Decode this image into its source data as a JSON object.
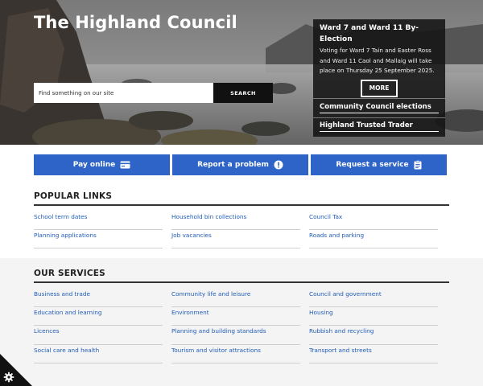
{
  "header": {
    "site_title": "The Highland Council"
  },
  "search": {
    "placeholder": "Find something on our site",
    "button_label": "SEARCH"
  },
  "news_panel": {
    "title": "Ward 7 and Ward 11 By-Election",
    "body": "Voting for Ward 7 Tain and Easter Ross and Ward 11 Caol and Mallaig will take place on Thursday 25 September 2025.",
    "more_label": "MORE",
    "links": [
      "Community Council elections",
      "Highland Trusted Trader"
    ]
  },
  "actions": [
    {
      "label": "Pay online",
      "icon": "credit-card-icon"
    },
    {
      "label": "Report a problem",
      "icon": "alert-circle-icon"
    },
    {
      "label": "Request a service",
      "icon": "clipboard-icon"
    }
  ],
  "popular": {
    "title": "POPULAR LINKS",
    "links": [
      "School term dates",
      "Household bin collections",
      "Council Tax",
      "Planning applications",
      "Job vacancies",
      "Roads and parking"
    ]
  },
  "services": {
    "title": "OUR SERVICES",
    "links": [
      "Business and trade",
      "Community life and leisure",
      "Council and government",
      "Education and learning",
      "Environment",
      "Housing",
      "Licences",
      "Planning and building standards",
      "Rubbish and recycling",
      "Social care and health",
      "Tourism and visitor attractions",
      "Transport and streets"
    ]
  },
  "colors": {
    "accent_blue": "#2e63c8",
    "link_blue": "#1f5bb8",
    "panel_dark": "#141414"
  },
  "corner_icon": "gear-icon"
}
